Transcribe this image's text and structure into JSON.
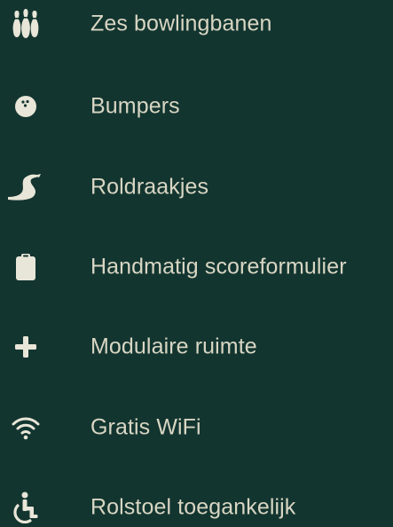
{
  "colors": {
    "background": "#133530",
    "text": "#d8d6c3",
    "icon": "#e8e6d8"
  },
  "amenities": [
    {
      "icon": "bowling-pins-icon",
      "label": "Zes bowlingbanen"
    },
    {
      "icon": "bowling-ball-icon",
      "label": "Bumpers"
    },
    {
      "icon": "ramp-icon",
      "label": "Roldraakjes"
    },
    {
      "icon": "clipboard-icon",
      "label": "Handmatig scoreformulier"
    },
    {
      "icon": "plus-icon",
      "label": "Modulaire ruimte"
    },
    {
      "icon": "wifi-icon",
      "label": "Gratis WiFi"
    },
    {
      "icon": "wheelchair-icon",
      "label": "Rolstoel toegankelijk"
    }
  ]
}
